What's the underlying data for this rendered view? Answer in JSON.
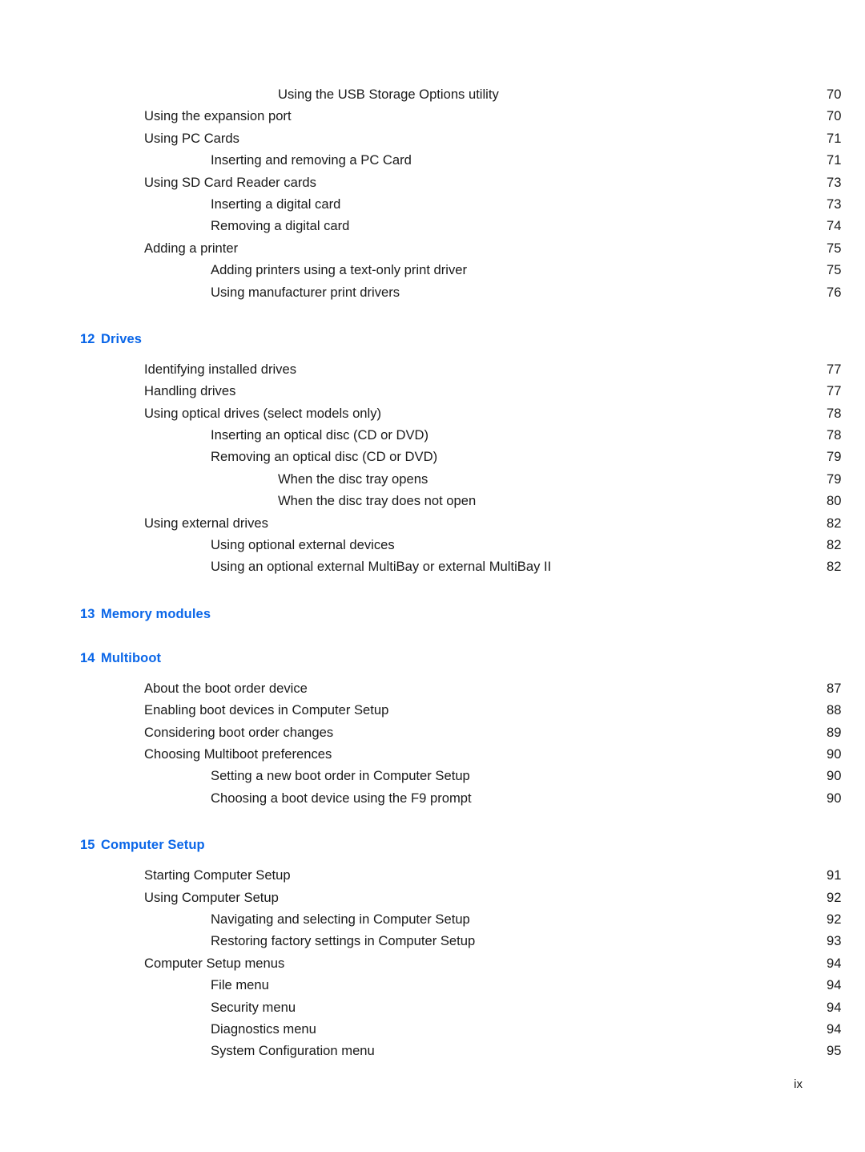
{
  "document": {
    "type": "table-of-contents",
    "page_label": "ix",
    "heading_color": "#0a66e8",
    "text_color": "#1a1a1a"
  },
  "sections": [
    {
      "kind": "entries",
      "entries": [
        {
          "level": 3,
          "label": "Using the USB Storage Options utility",
          "page": "70"
        },
        {
          "level": 1,
          "label": "Using the expansion port",
          "page": "70"
        },
        {
          "level": 1,
          "label": "Using PC Cards",
          "page": "71"
        },
        {
          "level": 2,
          "label": "Inserting and removing a PC Card",
          "page": "71"
        },
        {
          "level": 1,
          "label": "Using SD Card Reader cards",
          "page": "73"
        },
        {
          "level": 2,
          "label": "Inserting a digital card",
          "page": "73"
        },
        {
          "level": 2,
          "label": "Removing a digital card",
          "page": "74"
        },
        {
          "level": 1,
          "label": "Adding a printer",
          "page": "75"
        },
        {
          "level": 2,
          "label": "Adding printers using a text-only print driver",
          "page": "75"
        },
        {
          "level": 2,
          "label": "Using manufacturer print drivers",
          "page": "76"
        }
      ]
    },
    {
      "kind": "chapter",
      "number": "12",
      "title": "Drives",
      "entries": [
        {
          "level": 1,
          "label": "Identifying installed drives",
          "page": "77"
        },
        {
          "level": 1,
          "label": "Handling drives",
          "page": "77"
        },
        {
          "level": 1,
          "label": "Using optical drives (select models only)",
          "page": "78"
        },
        {
          "level": 2,
          "label": "Inserting an optical disc (CD or DVD)",
          "page": "78"
        },
        {
          "level": 2,
          "label": "Removing an optical disc (CD or DVD)",
          "page": "79"
        },
        {
          "level": 3,
          "label": "When the disc tray opens",
          "page": "79"
        },
        {
          "level": 3,
          "label": "When the disc tray does not open",
          "page": "80"
        },
        {
          "level": 1,
          "label": "Using external drives",
          "page": "82"
        },
        {
          "level": 2,
          "label": "Using optional external devices",
          "page": "82"
        },
        {
          "level": 2,
          "label": "Using an optional external MultiBay or external MultiBay II",
          "page": "82"
        }
      ]
    },
    {
      "kind": "chapter",
      "number": "13",
      "title": "Memory modules",
      "entries": []
    },
    {
      "kind": "chapter",
      "number": "14",
      "title": "Multiboot",
      "entries": [
        {
          "level": 1,
          "label": "About the boot order device",
          "page": "87"
        },
        {
          "level": 1,
          "label": "Enabling boot devices in Computer Setup",
          "page": "88"
        },
        {
          "level": 1,
          "label": "Considering boot order changes",
          "page": "89"
        },
        {
          "level": 1,
          "label": "Choosing Multiboot preferences",
          "page": "90"
        },
        {
          "level": 2,
          "label": "Setting a new boot order in Computer Setup",
          "page": "90",
          "wide_gap": true
        },
        {
          "level": 2,
          "label": "Choosing a boot device using the F9 prompt",
          "page": "90"
        }
      ]
    },
    {
      "kind": "chapter",
      "number": "15",
      "title": "Computer Setup",
      "entries": [
        {
          "level": 1,
          "label": "Starting Computer Setup",
          "page": "91"
        },
        {
          "level": 1,
          "label": "Using Computer Setup",
          "page": "92"
        },
        {
          "level": 2,
          "label": "Navigating and selecting in Computer Setup",
          "page": "92"
        },
        {
          "level": 2,
          "label": "Restoring factory settings in Computer Setup",
          "page": "93"
        },
        {
          "level": 1,
          "label": "Computer Setup menus",
          "page": "94"
        },
        {
          "level": 2,
          "label": "File menu",
          "page": "94"
        },
        {
          "level": 2,
          "label": "Security menu",
          "page": "94"
        },
        {
          "level": 2,
          "label": "Diagnostics menu",
          "page": "94"
        },
        {
          "level": 2,
          "label": "System Configuration menu",
          "page": "95"
        }
      ]
    }
  ]
}
